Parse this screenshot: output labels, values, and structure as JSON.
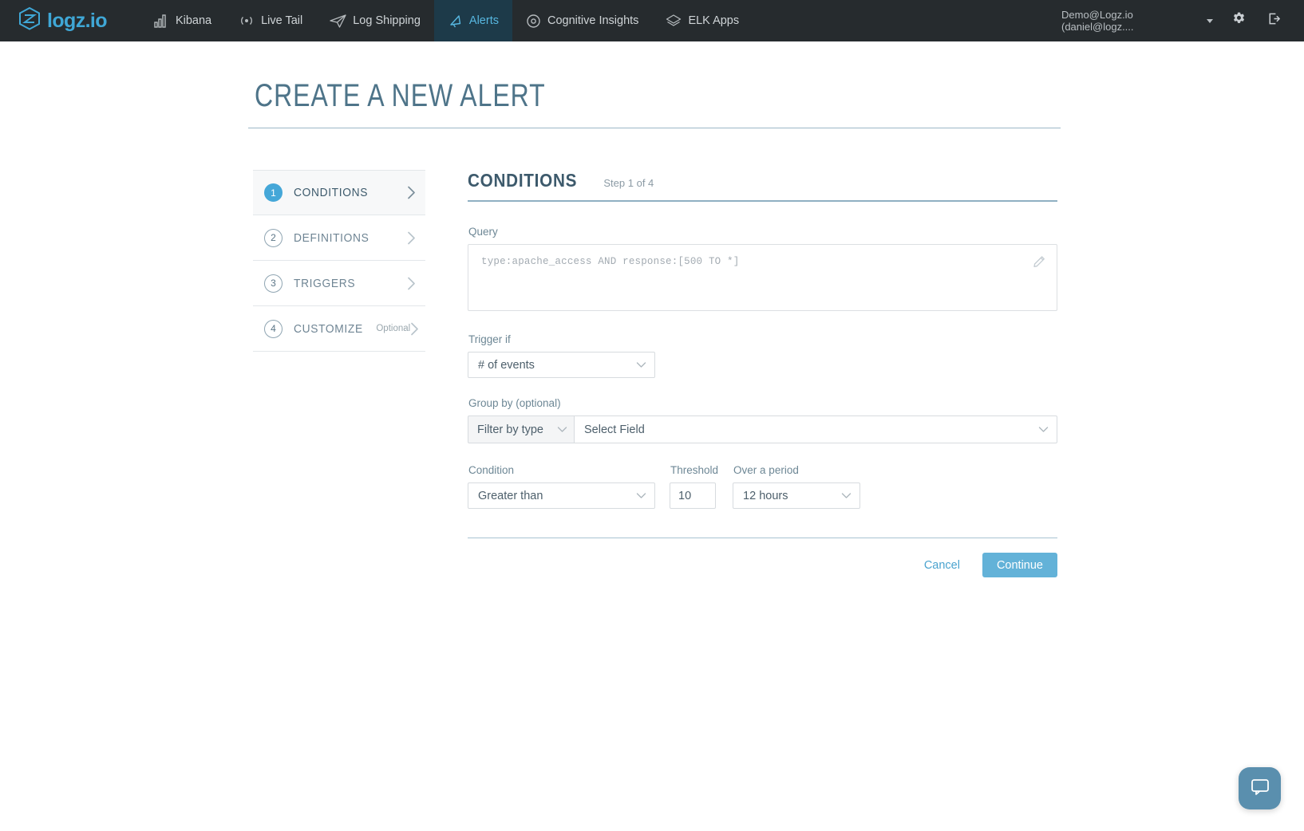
{
  "navbar": {
    "brand": {
      "text": "logz.io",
      "icon": "logz-cube-logo"
    },
    "items": [
      {
        "label": "Kibana",
        "icon": "bar-chart-icon",
        "active": false
      },
      {
        "label": "Live Tail",
        "icon": "broadcast-icon",
        "active": false
      },
      {
        "label": "Log Shipping",
        "icon": "paper-plane-icon",
        "active": false
      },
      {
        "label": "Alerts",
        "icon": "alert-bell-icon",
        "active": true
      },
      {
        "label": "Cognitive Insights",
        "icon": "eye-target-icon",
        "active": false
      },
      {
        "label": "ELK Apps",
        "icon": "layers-icon",
        "active": false
      }
    ],
    "user": {
      "label": "Demo@Logz.io (daniel@logz....",
      "caret_icon": "caret-down-icon"
    },
    "settings_icon": "gear-icon",
    "logout_icon": "logout-icon"
  },
  "page": {
    "title": "CREATE A NEW ALERT"
  },
  "steps": [
    {
      "num": "1",
      "label": "CONDITIONS",
      "optional": "",
      "active": true
    },
    {
      "num": "2",
      "label": "DEFINITIONS",
      "optional": "",
      "active": false
    },
    {
      "num": "3",
      "label": "TRIGGERS",
      "optional": "",
      "active": false
    },
    {
      "num": "4",
      "label": "CUSTOMIZE",
      "optional": "Optional",
      "active": false
    }
  ],
  "panel": {
    "title": "CONDITIONS",
    "step_indicator": "Step 1 of 4",
    "query": {
      "label": "Query",
      "value": "",
      "placeholder": "type:apache_access AND response:[500 TO *]",
      "edit_icon": "pencil-icon"
    },
    "trigger_if": {
      "label": "Trigger if",
      "value": "# of events",
      "options": [
        "# of events"
      ]
    },
    "group_by": {
      "label": "Group by (optional)",
      "filter_type_value": "Filter by type",
      "select_field_value": "Select Field"
    },
    "condition": {
      "label": "Condition",
      "value": "Greater than",
      "options": [
        "Greater than"
      ]
    },
    "threshold": {
      "label": "Threshold",
      "value": "10"
    },
    "period": {
      "label": "Over a period",
      "value": "12 hours",
      "options": [
        "12 hours"
      ]
    },
    "cancel_label": "Cancel",
    "continue_label": "Continue"
  },
  "chat": {
    "icon": "chat-bubble-icon"
  },
  "colors": {
    "nav_bg": "#262b2e",
    "nav_active_bg": "#1d3a49",
    "accent": "#45a7d8",
    "primary_button": "#63b2d8",
    "title_text": "#4e7489"
  }
}
